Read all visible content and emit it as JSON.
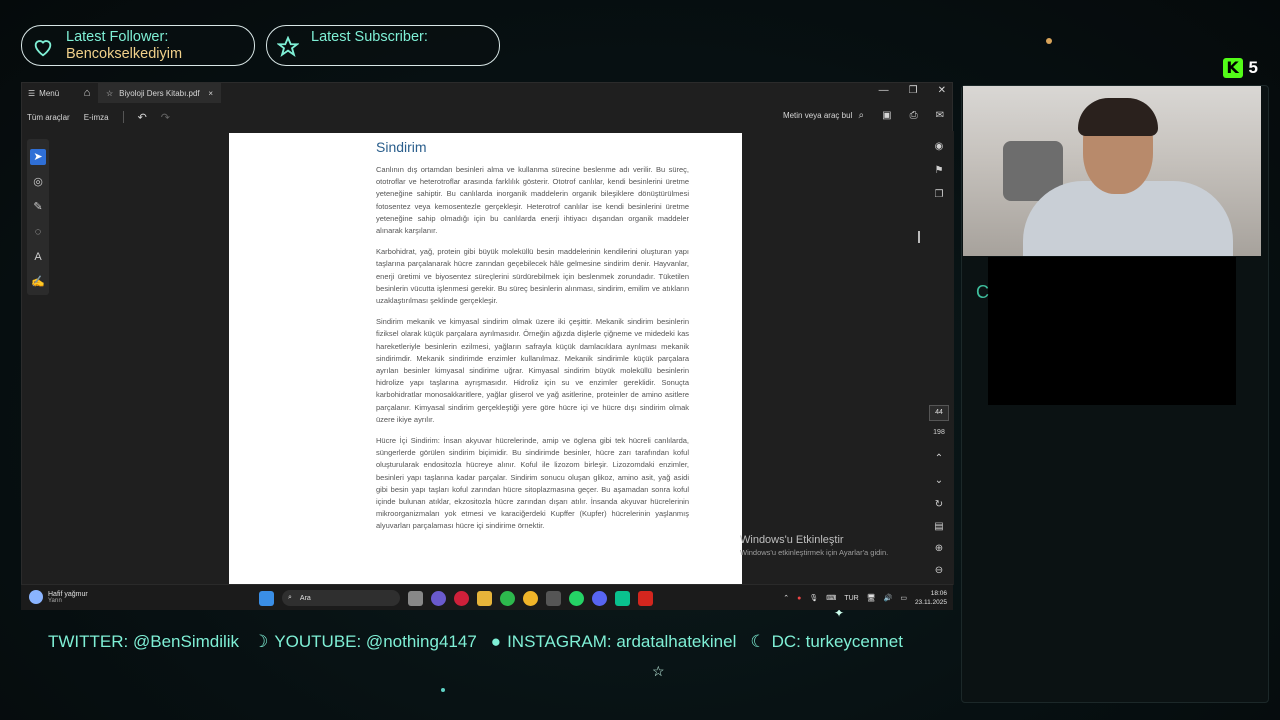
{
  "overlay": {
    "follower_label": "Latest Follower:",
    "follower_value": "Bencokselkediyim",
    "subscriber_label": "Latest Subscriber:",
    "subscriber_value": "",
    "kick_count": "5",
    "cam_letter": "C"
  },
  "window": {
    "menu_label": "Menü",
    "tab_title": "Biyoloji Ders Kitabı.pdf",
    "tab_close": "×",
    "controls": [
      "—",
      "❐",
      "✕"
    ]
  },
  "toolbar": {
    "all_tools": "Tüm araçlar",
    "esign": "E-imza",
    "search_label": "Metin veya araç bul"
  },
  "viewer": {
    "current_page": "44",
    "total_pages": "198"
  },
  "document": {
    "heading": "Sindirim",
    "p1": "Canlının dış ortamdan besinleri alma ve kullanma sürecine beslenme adı verilir. Bu süreç, ototroflar ve heterotroflar arasında farklılık gösterir. Ototrof canlılar, kendi besinlerini üretme yeteneğine sahiptir. Bu canlılarda inorganik maddelerin organik bileşiklere dönüştürülmesi fotosentez veya kemosentezle gerçekleşir. Heterotrof canlılar ise kendi besinlerini üretme yeteneğine sahip olmadığı için bu canlılarda enerji ihtiyacı dışarıdan organik maddeler alınarak karşılanır.",
    "p2": "Karbohidrat, yağ, protein gibi büyük moleküllü besin maddelerinin kendilerini oluşturan yapı taşlarına parçalanarak hücre zarından geçebilecek hâle gelmesine sindirim denir. Hayvanlar, enerji üretimi ve biyosentez süreçlerini sürdürebilmek için beslenmek zorundadır. Tüketilen besinlerin vücutta işlenmesi gerekir. Bu süreç besinlerin alınması, sindirim, emilim ve atıkların uzaklaştırılması şeklinde gerçekleşir.",
    "p3": "Sindirim mekanik ve kimyasal sindirim olmak üzere iki çeşittir. Mekanik sindirim besinlerin fiziksel olarak küçük parçalara ayrılmasıdır. Örneğin ağızda dişlerle çiğneme ve midedeki kas hareketleriyle besinlerin ezilmesi, yağların safrayla küçük damlacıklara ayrılması mekanik sindirimdir. Mekanik sindirimde enzimler kullanılmaz. Mekanik sindirimle küçük parçalara ayrılan besinler kimyasal sindirime uğrar. Kimyasal sindirim büyük moleküllü besinlerin hidrolize yapı taşlarına ayrışmasıdır. Hidroliz için su ve enzimler gereklidir. Sonuçta karbohidratlar monosakkaritlere, yağlar gliserol ve yağ asitlerine, proteinler de amino asitlere parçalanır. Kimyasal sindirim gerçekleştiği yere göre hücre içi ve hücre dışı sindirim olmak üzere ikiye ayrılır.",
    "p4": "Hücre İçi Sindirim: İnsan akyuvar hücrelerinde, amip ve öglena gibi tek hücreli canlılarda, süngerlerde görülen sindirim biçimidir. Bu sindirimde besinler, hücre zarı tarafından koful oluşturularak endositozla hücreye alınır. Koful ile lizozom birleşir. Lizozomdaki enzimler, besinleri yapı taşlarına kadar parçalar. Sindirim sonucu oluşan glikoz, amino asit, yağ asidi gibi besin yapı taşları koful zarından hücre sitoplazmasına geçer. Bu aşamadan sonra koful içinde bulunan atıklar, ekzositozla hücre zarından dışarı atılır. İnsanda akyuvar hücrelerinin mikroorganizmaları yok etmesi ve karaciğerdeki Kupffer (Kupfer) hücrelerinin yaşlanmış alyuvarları parçalaması hücre içi sindirime örnektir."
  },
  "activation": {
    "title": "Windows'u Etkinleştir",
    "subtitle": "Windows'u etkinleştirmek için Ayarlar'a gidin."
  },
  "taskbar": {
    "weather_title": "Hafif yağmur",
    "weather_sub": "Yarın",
    "search_placeholder": "Ara",
    "lang": "TUR",
    "time": "18:06",
    "date": "23.11.2025"
  },
  "socials": {
    "twitter": "TWITTER: @BenSimdilik",
    "youtube": "YOUTUBE: @nothing4147",
    "instagram": "INSTAGRAM: ardatalhatekinel",
    "discord": "DC: turkeycennet"
  },
  "colors": {
    "accent_teal": "#7ff0d6",
    "follower_gold": "#f0d08a",
    "kick_green": "#53fc18",
    "heading_blue": "#2a5e8c"
  }
}
